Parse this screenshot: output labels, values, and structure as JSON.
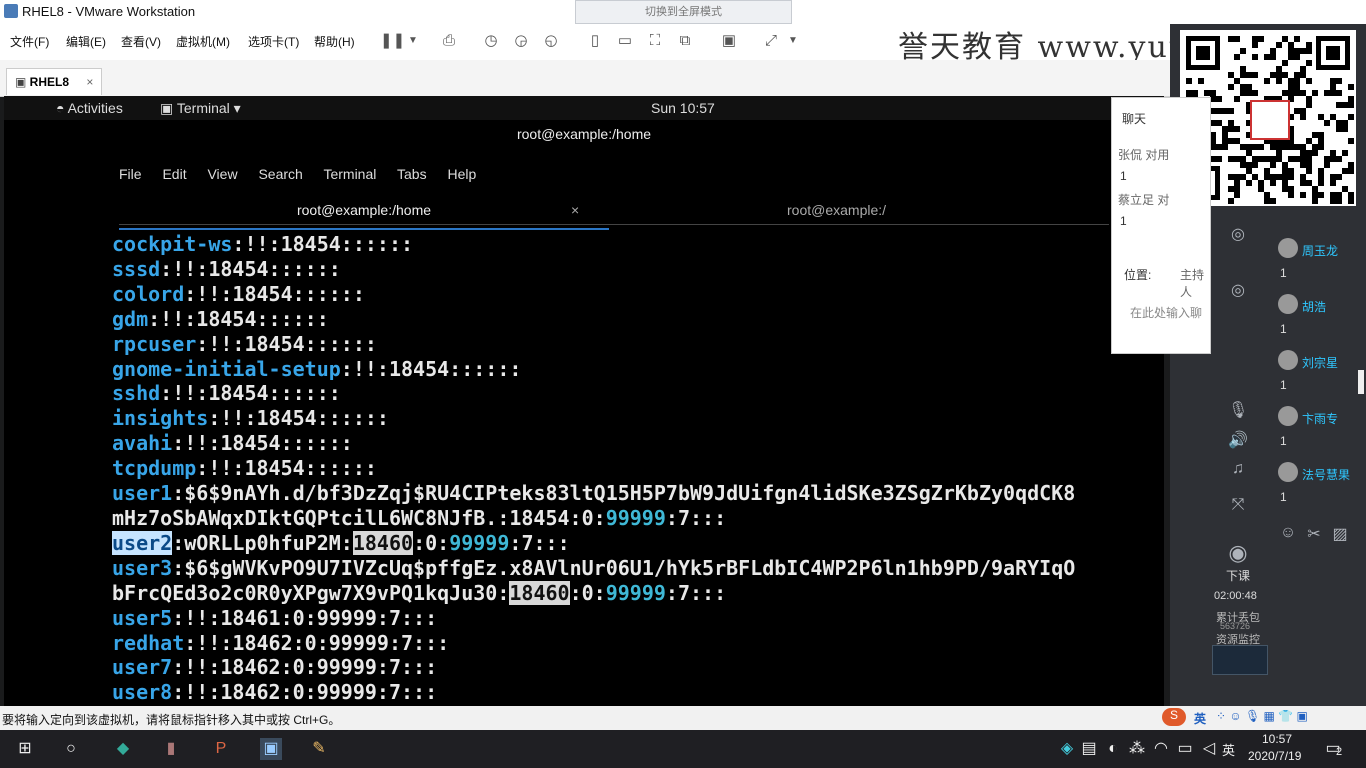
{
  "window": {
    "title": "RHEL8 - VMware Workstation",
    "notice": "切换到全屏模式"
  },
  "menu": [
    "文件(F)",
    "编辑(E)",
    "查看(V)",
    "虚拟机(M)",
    "选项卡(T)",
    "帮助(H)"
  ],
  "watermark": "誉天教育  www.yut",
  "vm_tab": {
    "label": "RHEL8",
    "close": "×"
  },
  "gnome": {
    "activities": "Activities",
    "app": "Terminal ▾",
    "clock": "Sun 10:57"
  },
  "terminal": {
    "title": "root@example:/home",
    "menu": [
      "File",
      "Edit",
      "View",
      "Search",
      "Terminal",
      "Tabs",
      "Help"
    ],
    "tabs": [
      {
        "label": "root@example:/home",
        "close": "×"
      },
      {
        "label": "root@example:/"
      }
    ],
    "lines": [
      [
        {
          "c": "u",
          "t": "cockpit-ws"
        },
        {
          "t": ":!!:18454::::::"
        }
      ],
      [
        {
          "c": "u",
          "t": "sssd"
        },
        {
          "t": ":!!:18454::::::"
        }
      ],
      [
        {
          "c": "u",
          "t": "colord"
        },
        {
          "t": ":!!:18454::::::"
        }
      ],
      [
        {
          "c": "u",
          "t": "gdm"
        },
        {
          "t": ":!!:18454::::::"
        }
      ],
      [
        {
          "c": "u",
          "t": "rpcuser"
        },
        {
          "t": ":!!:18454::::::"
        }
      ],
      [
        {
          "c": "u",
          "t": "gnome-initial-setup"
        },
        {
          "t": ":!!:18454::::::"
        }
      ],
      [
        {
          "c": "u",
          "t": "sshd"
        },
        {
          "t": ":!!:18454::::::"
        }
      ],
      [
        {
          "c": "u",
          "t": "insights"
        },
        {
          "t": ":!!:18454::::::"
        }
      ],
      [
        {
          "c": "u",
          "t": "avahi"
        },
        {
          "t": ":!!:18454::::::"
        }
      ],
      [
        {
          "c": "u",
          "t": "tcpdump"
        },
        {
          "t": ":!!:18454::::::"
        }
      ],
      [
        {
          "c": "u",
          "t": "user1"
        },
        {
          "t": ":$6$9nAYh.d/bf3DzZqj$RU4CIPteks83ltQ15H5P7bW9JdUifgn4lidSKe3ZSgZrKbZy0qdCK8"
        }
      ],
      [
        {
          "t": "mHz7oSbAWqxDIktGQPtcilL6WC8NJfB.:18454:0:"
        },
        {
          "c": "cy",
          "t": "99999"
        },
        {
          "t": ":7:::"
        }
      ],
      [
        {
          "c": "sel",
          "t": "user2"
        },
        {
          "t": ":wORLLp0hfuP2M:"
        },
        {
          "c": "hl",
          "t": "18460"
        },
        {
          "t": ":0:"
        },
        {
          "c": "cy",
          "t": "99999"
        },
        {
          "t": ":7:::"
        }
      ],
      [
        {
          "c": "u",
          "t": "user3"
        },
        {
          "t": ":$6$gWVKvPO9U7IVZcUq$pffgEz.x8AVlnUr06U1/hYk5rBFLdbIC4WP2P6ln1hb9PD/9aRYIqO"
        }
      ],
      [
        {
          "t": "bFrcQEd3o2c0R0yXPgw7X9vPQ1kqJu30:"
        },
        {
          "c": "hl",
          "t": "18460"
        },
        {
          "t": ":0:"
        },
        {
          "c": "cy",
          "t": "99999"
        },
        {
          "t": ":7:::"
        }
      ],
      [
        {
          "c": "u",
          "t": "user5"
        },
        {
          "t": ":!!:18461:0:99999:7:::"
        }
      ],
      [
        {
          "c": "u",
          "t": "redhat"
        },
        {
          "t": ":!!:18462:0:99999:7:::"
        }
      ],
      [
        {
          "c": "u",
          "t": "user7"
        },
        {
          "t": ":!!:18462:0:99999:7:::"
        }
      ],
      [
        {
          "c": "u",
          "t": "user8"
        },
        {
          "t": ":!!:18462:0:99999:7:::"
        }
      ]
    ]
  },
  "chat": {
    "header": "聊天",
    "rows": [
      "张侃 对用",
      "1",
      "蔡立足 对",
      "1"
    ],
    "position_label": "位置:",
    "position_value": "主持人",
    "input_placeholder": "在此处输入聊"
  },
  "attendees": [
    {
      "name": "周玉龙",
      "count": "1"
    },
    {
      "name": "胡浩",
      "count": "1"
    },
    {
      "name": "刘宗星",
      "count": "1"
    },
    {
      "name": "卞雨专",
      "count": "1"
    },
    {
      "name": "法号慧果",
      "count": "1"
    }
  ],
  "side": {
    "leave": "下课",
    "timer": "02:00:48",
    "stats1": "累计丢包",
    "stats2": "563726",
    "stats3": "资源监控"
  },
  "statusbar": {
    "text": "要将输入定向到该虚拟机，请将鼠标指针移入其中或按 Ctrl+G。",
    "ime": "英"
  },
  "taskbar": {
    "time": "10:57",
    "date": "2020/7/19",
    "lang": "英",
    "notify": "2"
  },
  "colors": {
    "user_name": "#38a5e8",
    "terminal_bg": "#000000",
    "selection": "#c6e4ff",
    "accent": "#2a76c6"
  }
}
